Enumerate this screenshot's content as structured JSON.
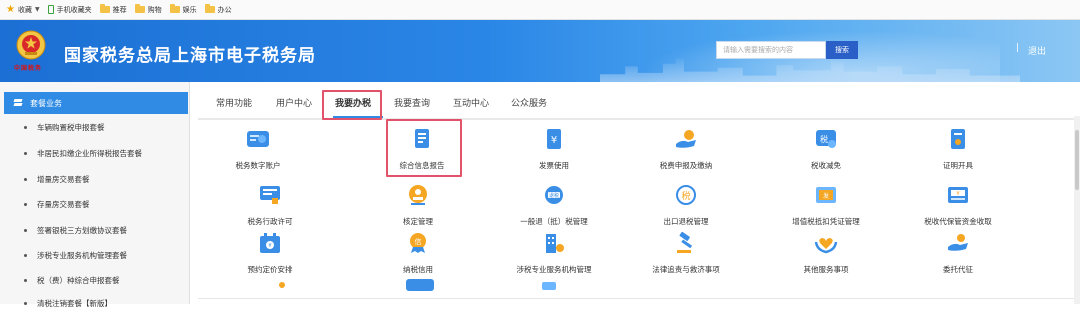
{
  "bookmarks": {
    "items": [
      "收藏",
      "手机收藏夹",
      "推荐",
      "购物",
      "娱乐",
      "办公"
    ]
  },
  "header": {
    "emblem_text": "中国税务",
    "title": "国家税务总局上海市电子税务局",
    "search_placeholder": "请输入需要搜索的内容",
    "search_button": "搜索",
    "logout_sep": "|",
    "logout": "退出"
  },
  "sidebar": {
    "header": "套餐业务",
    "items": [
      "车辆购置税申报套餐",
      "非居民扣缴企业所得税报告套餐",
      "增量房交易套餐",
      "存量房交易套餐",
      "签署银税三方划缴协议套餐",
      "涉税专业服务机构管理套餐",
      "税（费）种综合申报套餐",
      "清税注销套餐【新版】"
    ]
  },
  "tabs": [
    "常用功能",
    "用户中心",
    "我要办税",
    "我要查询",
    "互动中心",
    "公众服务"
  ],
  "active_tab": "我要办税",
  "grid": [
    {
      "label": "税务数字账户",
      "icon": "digital-account-icon"
    },
    {
      "label": "综合信息报告",
      "icon": "document-report-icon"
    },
    {
      "label": "发票使用",
      "icon": "invoice-icon"
    },
    {
      "label": "税费申报及缴纳",
      "icon": "tax-payment-icon"
    },
    {
      "label": "税收减免",
      "icon": "tax-reduction-icon"
    },
    {
      "label": "证明开具",
      "icon": "certificate-icon"
    },
    {
      "label": "税务行政许可",
      "icon": "admin-license-icon"
    },
    {
      "label": "核定管理",
      "icon": "approval-stamp-icon"
    },
    {
      "label": "一般退（抵）税管理",
      "icon": "tax-refund-icon"
    },
    {
      "label": "出口退税管理",
      "icon": "export-refund-icon"
    },
    {
      "label": "增值税抵扣凭证管理",
      "icon": "vat-voucher-icon"
    },
    {
      "label": "税收代保管资金收取",
      "icon": "fund-custody-icon"
    },
    {
      "label": "预约定价安排",
      "icon": "calendar-pricing-icon"
    },
    {
      "label": "纳税信用",
      "icon": "tax-credit-icon"
    },
    {
      "label": "涉税专业服务机构管理",
      "icon": "agency-building-icon"
    },
    {
      "label": "法律追责与救济事项",
      "icon": "gavel-icon"
    },
    {
      "label": "其他服务事项",
      "icon": "heart-hands-icon"
    },
    {
      "label": "委托代征",
      "icon": "entrust-hand-icon"
    }
  ],
  "colors": {
    "header_start": "#1c6fd4",
    "accent": "#2f8be4",
    "highlight": "#e2526a",
    "icon_blue": "#3a8ee6",
    "icon_orange": "#f5a623"
  }
}
